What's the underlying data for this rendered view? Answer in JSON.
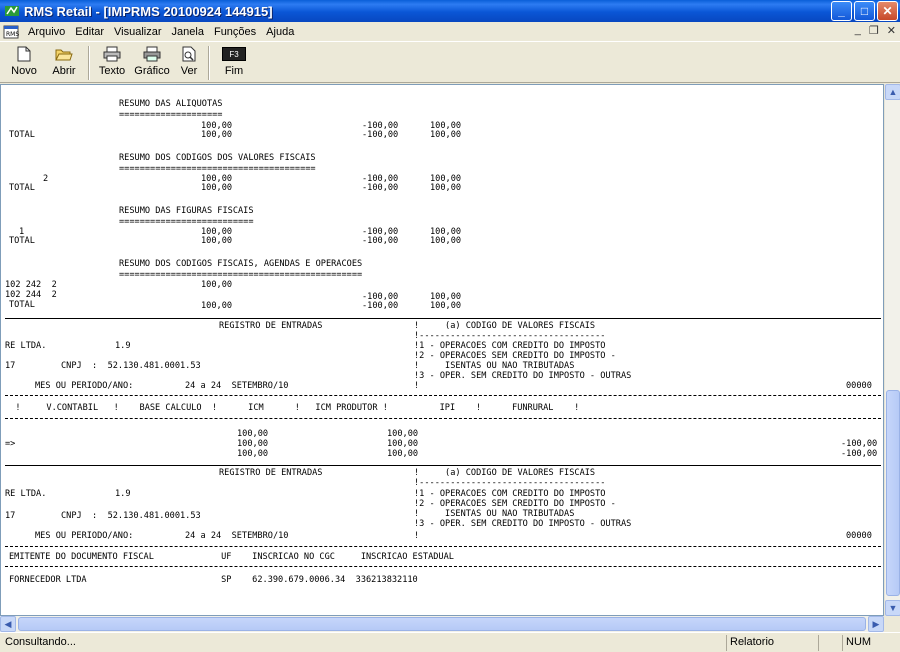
{
  "window": {
    "title": "RMS Retail - [IMPRMS 20100924 144915]",
    "controls": {
      "minimize": "_",
      "maximize": "□",
      "close": "✕"
    }
  },
  "menu": {
    "items": [
      "Arquivo",
      "Editar",
      "Visualizar",
      "Janela",
      "Funções",
      "Ajuda"
    ],
    "mdi_controls": {
      "minimize": "_",
      "restore": "❐",
      "close": "✕"
    }
  },
  "toolbar": {
    "buttons": [
      {
        "label": "Novo",
        "icon": "new-document-icon"
      },
      {
        "label": "Abrir",
        "icon": "open-folder-icon"
      },
      {
        "label": "Texto",
        "icon": "printer-icon"
      },
      {
        "label": "Gráfico",
        "icon": "printer-color-icon"
      },
      {
        "label": "Ver",
        "icon": "preview-icon"
      },
      {
        "label": "Fim",
        "key": "F3",
        "icon": "exit-key-icon"
      }
    ]
  },
  "report": {
    "s1": {
      "title": "RESUMO DAS ALIQUOTAS",
      "underline": "====================",
      "row_v1": "100,00",
      "row_v2": "-100,00",
      "row_v3": "100,00",
      "total_label": "TOTAL",
      "total_v1": "100,00",
      "total_v2": "-100,00",
      "total_v3": "100,00"
    },
    "s2": {
      "title": "RESUMO DOS CODIGOS DOS VALORES FISCAIS",
      "underline": "======================================",
      "row_code": "2",
      "row_v1": "100,00",
      "row_v2": "-100,00",
      "row_v3": "100,00",
      "total_label": "TOTAL",
      "total_v1": "100,00",
      "total_v2": "-100,00",
      "total_v3": "100,00"
    },
    "s3": {
      "title": "RESUMO DAS FIGURAS FISCAIS",
      "underline": "==========================",
      "row_code": "1",
      "row_v1": "100,00",
      "row_v2": "-100,00",
      "row_v3": "100,00",
      "total_label": "TOTAL",
      "total_v1": "100,00",
      "total_v2": "-100,00",
      "total_v3": "100,00"
    },
    "s4": {
      "title": "RESUMO DOS CODIGOS FISCAIS, AGENDAS E OPERACOES",
      "underline": "===============================================",
      "row1_code": "102 242  2",
      "row1_v1": "100,00",
      "row2_code": "102 244  2",
      "row2_v2": "-100,00",
      "row2_v3": "100,00",
      "total_label": "TOTAL",
      "total_v1": "100,00",
      "total_v2": "-100,00",
      "total_v3": "100,00"
    },
    "header1": {
      "title": "REGISTRO DE ENTRADAS",
      "legend_title": "!     (a) CODIGO DE VALORES FISCAIS",
      "legend_rule": "!------------------------------------",
      "company": "RE LTDA.",
      "company_code": "1.9",
      "legend_1": "!1 - OPERACOES COM CREDITO DO IMPOSTO",
      "legend_2": "!2 - OPERACOES SEM CREDITO DO IMPOSTO -",
      "branch": "17",
      "cnpj": "CNPJ  :  52.130.481.0001.53",
      "legend_2b": "!     ISENTAS OU NAO TRIBUTADAS",
      "legend_3": "!3 - OPER. SEM CREDITO DO IMPOSTO - OUTRAS",
      "period_label": "MES OU PERIODO/ANO:",
      "period_value": "24 a 24  SETEMBRO/10",
      "legend_end": "!",
      "page": "00000"
    },
    "columns": "  !     V.CONTABIL   !    BASE CALCULO  !      ICM      !   ICM PRODUTOR !          IPI    !      FUNRURAL    !",
    "detail": {
      "arrow": "=>",
      "icm": [
        "100,00",
        "100,00",
        "100,00"
      ],
      "ipi": [
        "100,00",
        "100,00",
        "100,00"
      ],
      "right": [
        "-100,00",
        "-100,00"
      ]
    },
    "header2": {
      "title": "REGISTRO DE ENTRADAS",
      "legend_title": "!     (a) CODIGO DE VALORES FISCAIS",
      "legend_rule": "!------------------------------------",
      "company": "RE LTDA.",
      "company_code": "1.9",
      "legend_1": "!1 - OPERACOES COM CREDITO DO IMPOSTO",
      "legend_2": "!2 - OPERACOES SEM CREDITO DO IMPOSTO -",
      "branch": "17",
      "cnpj": "CNPJ  :  52.130.481.0001.53",
      "legend_2b": "!     ISENTAS OU NAO TRIBUTADAS",
      "legend_3": "!3 - OPER. SEM CREDITO DO IMPOSTO - OUTRAS",
      "period_label": "MES OU PERIODO/ANO:",
      "period_value": "24 a 24  SETEMBRO/10",
      "legend_end": "!",
      "page": "00000"
    },
    "emitter_header": "EMITENTE DO DOCUMENTO FISCAL             UF    INSCRICAO NO CGC     INSCRICAO ESTADUAL",
    "emitter_row": "FORNECEDOR LTDA                          SP    62.390.679.0006.34  336213832110"
  },
  "status": {
    "main": "Consultando...",
    "panel2": "Relatorio",
    "panel3": "",
    "panel4": "NUM"
  }
}
